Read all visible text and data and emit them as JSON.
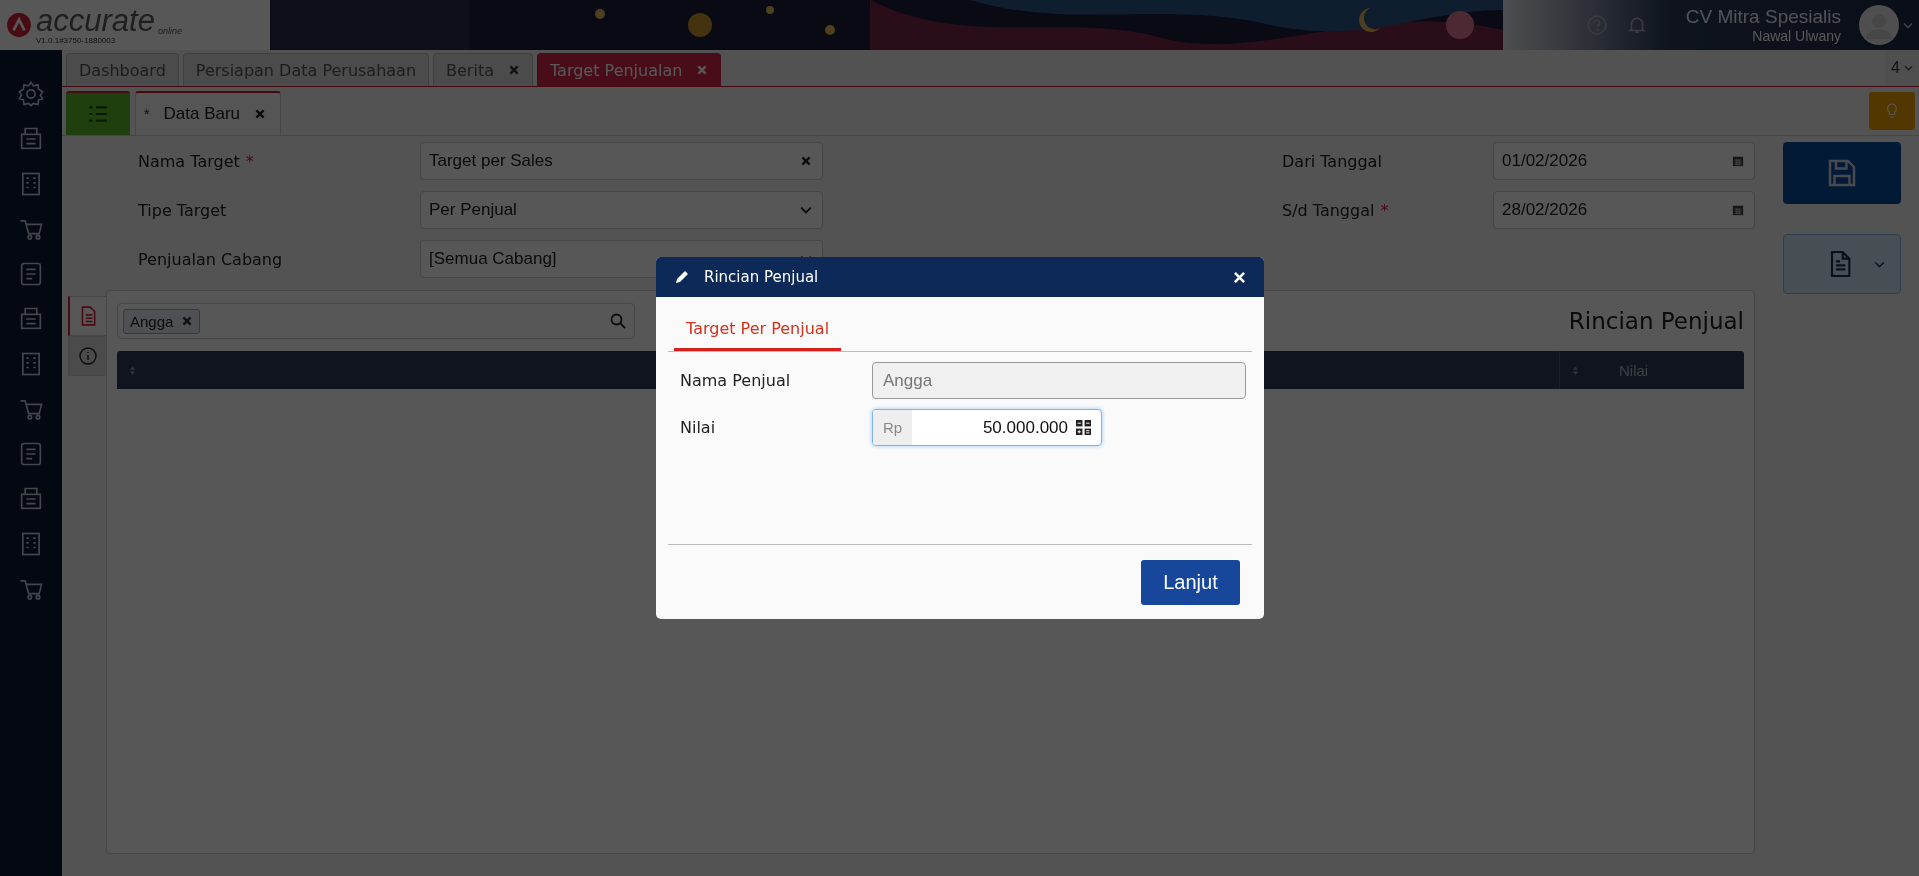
{
  "header": {
    "logo": "accurate",
    "logo_sub": "online",
    "version": "V1.0.1#3750-1880003",
    "company": "CV Mitra Spesialis",
    "user": "Nawal Ulwany"
  },
  "tabs": [
    {
      "label": "Dashboard",
      "closable": false,
      "selected": false
    },
    {
      "label": "Persiapan Data Perusahaan",
      "closable": false,
      "selected": false
    },
    {
      "label": "Berita",
      "closable": true,
      "selected": false
    },
    {
      "label": "Target Penjualan",
      "closable": true,
      "selected": true
    }
  ],
  "tab_count": "4",
  "subtabs": [
    {
      "label": "$^{*}$Data Baru",
      "selected": true
    }
  ],
  "form_left": [
    {
      "label": "Nama Target",
      "required_mark": "*",
      "value": "Target per Sales",
      "kind": "clearable"
    },
    {
      "label": "Tipe Target",
      "value": "Per Penjual",
      "kind": "select"
    },
    {
      "label": "Penjualan Cabang",
      "value": "[Semua Cabang]",
      "kind": "select"
    }
  ],
  "form_right": [
    {
      "label": "Dari Tanggal",
      "value": "01/02/2026",
      "kind": "date"
    },
    {
      "label": "S/d Tanggal",
      "required_mark": "*",
      "value": "28/02/2026",
      "kind": "date"
    }
  ],
  "panel": {
    "chips": [
      "Angga"
    ],
    "title": "Rincian Penjual",
    "columns": [
      {
        "sortable": true
      },
      {
        "label": "Nilai",
        "sortable": true
      }
    ]
  },
  "modal": {
    "title": "Rincian Penjual",
    "tabs": [
      {
        "label": "Target Per Penjual",
        "selected": true
      }
    ],
    "fields": [
      {
        "label": "Nama Penjual",
        "value": "Angga",
        "kind": "readonly"
      },
      {
        "label": "Nilai",
        "prefix": "Rp",
        "value": "50.000.000",
        "kind": "currency"
      }
    ],
    "button": "Lanjut"
  }
}
